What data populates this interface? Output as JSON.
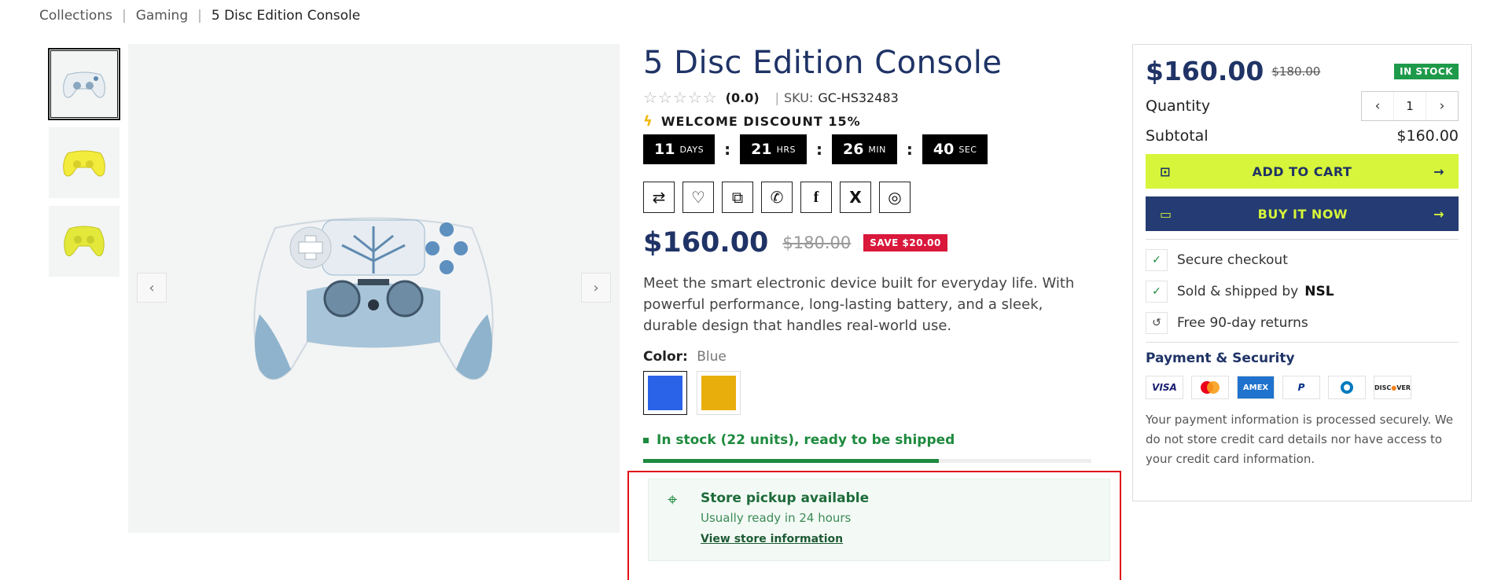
{
  "breadcrumb": {
    "items": [
      "Collections",
      "Gaming",
      "5 Disc Edition Console"
    ],
    "separator": "|"
  },
  "gallery": {
    "thumbnails": [
      {
        "color": "blue-white",
        "active": true
      },
      {
        "color": "yellow",
        "active": false
      },
      {
        "color": "yellow",
        "active": false
      }
    ],
    "prev_icon": "chevron-left-icon",
    "next_icon": "chevron-right-icon"
  },
  "product": {
    "title": "5 Disc Edition Console",
    "rating": "(0.0)",
    "sku_label": "SKU:",
    "sku": "GC-HS32483",
    "discount_label": "WELCOME DISCOUNT 15%",
    "countdown": [
      {
        "num": "11",
        "unit": "DAYS"
      },
      {
        "num": "21",
        "unit": "HRS"
      },
      {
        "num": "26",
        "unit": "MIN"
      },
      {
        "num": "40",
        "unit": "SEC"
      }
    ],
    "share_icons": [
      "compare-icon",
      "heart-icon",
      "copy-icon",
      "whatsapp-icon",
      "facebook-icon",
      "x-icon",
      "instagram-icon"
    ],
    "price": "$160.00",
    "old_price": "$180.00",
    "save_badge": "SAVE $20.00",
    "description": "Meet the smart electronic device built for everyday life. With powerful performance, long-lasting battery, and a sleek, durable design that handles real-world use.",
    "color_label": "Color:",
    "color_value": "Blue",
    "swatches": [
      {
        "name": "Blue",
        "hex": "#2b63e8",
        "selected": true
      },
      {
        "name": "Yellow",
        "hex": "#e8ae0c",
        "selected": false
      }
    ],
    "stock_text": "In stock (22 units), ready to be shipped",
    "stock_level": 0.66
  },
  "pickup": {
    "title": "Store pickup available",
    "subtitle": "Usually ready in 24 hours",
    "link": "View store information"
  },
  "card": {
    "price": "$160.00",
    "old_price": "$180.00",
    "badge": "IN STOCK",
    "quantity_label": "Quantity",
    "quantity_value": "1",
    "subtotal_label": "Subtotal",
    "subtotal_value": "$160.00",
    "add_to_cart": "ADD TO CART",
    "buy_now": "BUY IT NOW",
    "features": [
      {
        "text": "Secure checkout"
      },
      {
        "text": "Sold & shipped by",
        "bold": "NSL"
      },
      {
        "text": "Free 90-day returns"
      }
    ],
    "payment_title": "Payment & Security",
    "payment_methods": [
      "VISA",
      "Mastercard",
      "AMEX",
      "PayPal",
      "Diners",
      "DISCOVER"
    ],
    "payment_text": "Your payment information is processed securely. We do not store credit card details nor have access to your credit card information."
  },
  "colors": {
    "brand_navy": "#1f3366",
    "accent_lime": "#d7f53a",
    "stock_green": "#1e8a3e",
    "sale_red": "#d9183b",
    "highlight_red": "#e0101a"
  }
}
